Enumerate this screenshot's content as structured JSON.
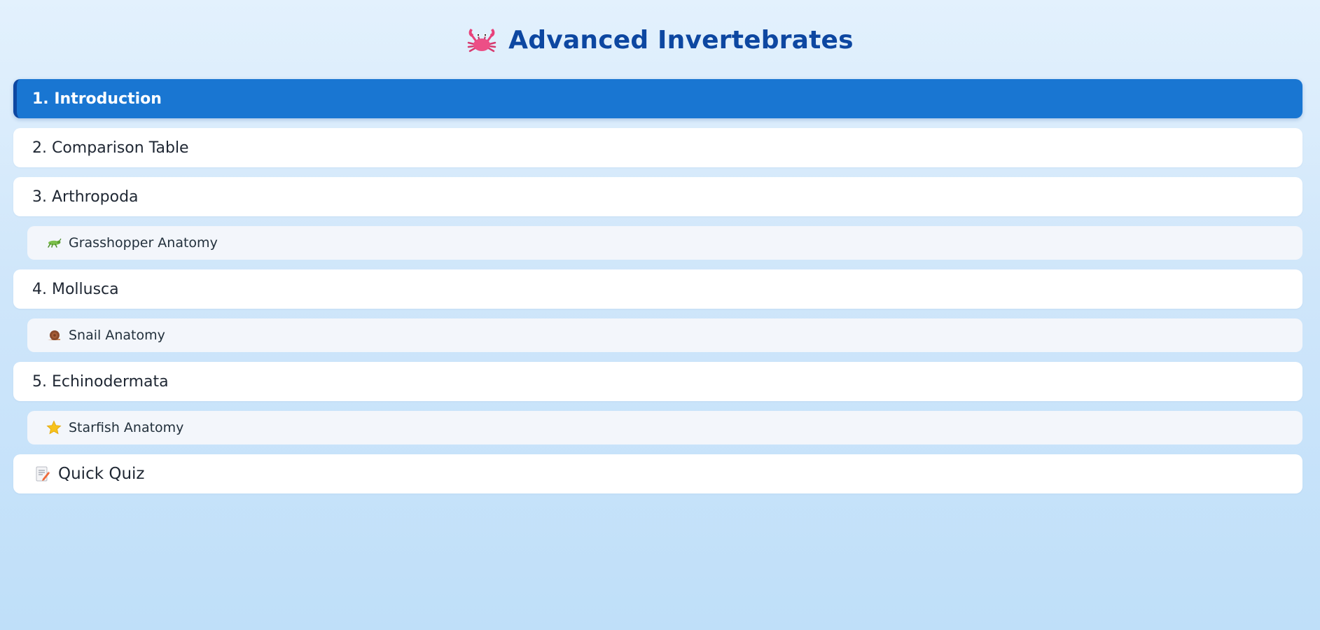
{
  "header": {
    "icon": "crab-icon",
    "title": "Advanced Invertebrates"
  },
  "nav": {
    "items": [
      {
        "label": "1. Introduction",
        "active": true
      },
      {
        "label": "2. Comparison Table"
      },
      {
        "label": "3. Arthropoda"
      },
      {
        "label": "Grasshopper Anatomy",
        "icon": "grasshopper-icon",
        "sub": true
      },
      {
        "label": "4. Mollusca"
      },
      {
        "label": "Snail Anatomy",
        "icon": "snail-icon",
        "sub": true
      },
      {
        "label": "5. Echinodermata"
      },
      {
        "label": "Starfish Anatomy",
        "icon": "star-icon",
        "sub": true
      },
      {
        "label": "Quick Quiz",
        "icon": "memo-icon"
      }
    ]
  },
  "colors": {
    "accent": "#1976d2",
    "accent_dark": "#0d47a1",
    "title": "#0d47a1",
    "item_bg": "#ffffff",
    "sub_bg": "#f3f6fb"
  }
}
